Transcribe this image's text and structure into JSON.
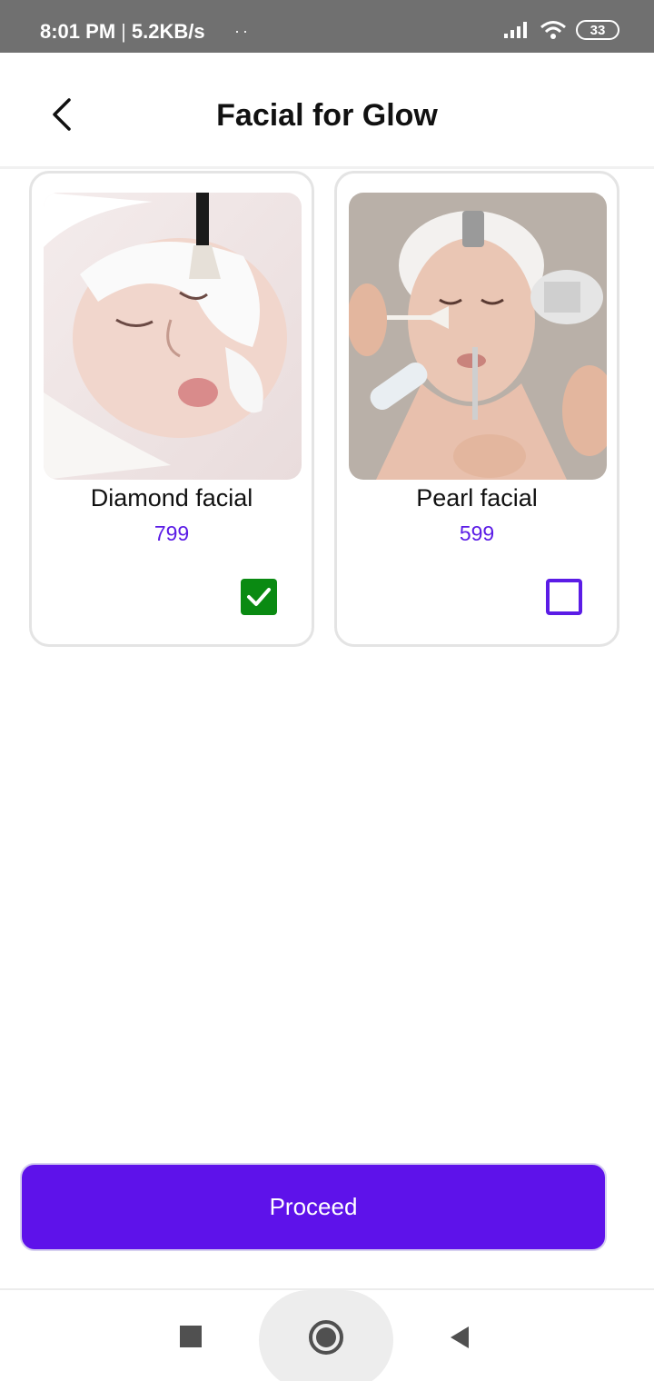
{
  "status_bar": {
    "time": "8:01 PM",
    "separator": "|",
    "speed": "5.2KB/s",
    "dots": "··",
    "battery": "33"
  },
  "header": {
    "title": "Facial for Glow"
  },
  "services": [
    {
      "name": "Diamond facial",
      "price": "799",
      "selected": true,
      "image_icon": "facial-mask-photo"
    },
    {
      "name": "Pearl facial",
      "price": "599",
      "selected": false,
      "image_icon": "facial-treatment-photo"
    }
  ],
  "footer": {
    "proceed_label": "Proceed"
  },
  "colors": {
    "accent": "#5e12ea",
    "price": "#5b1ce6",
    "checked": "#0a8a12",
    "status_bar": "#707070"
  }
}
